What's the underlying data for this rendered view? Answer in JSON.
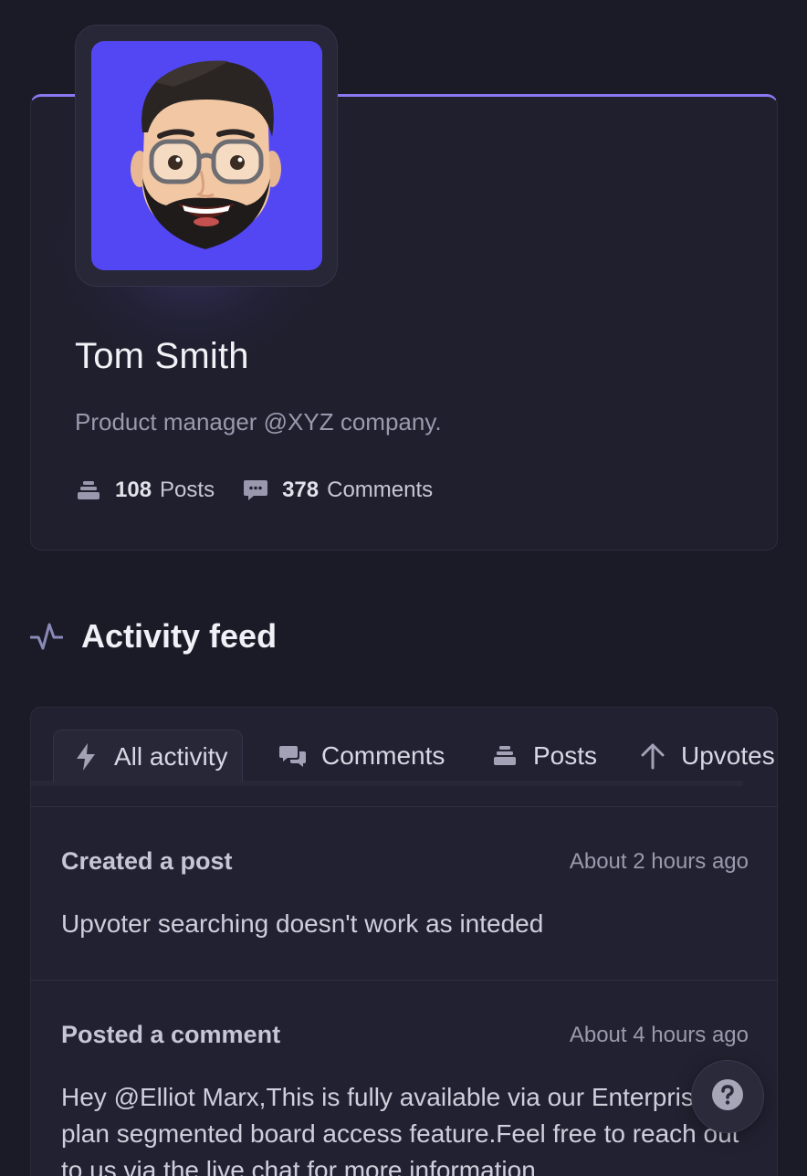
{
  "profile": {
    "name": "Tom Smith",
    "bio": "Product manager @XYZ company.",
    "stats": [
      {
        "count": "108",
        "label": "Posts",
        "icon": "stack-icon"
      },
      {
        "count": "378",
        "label": "Comments",
        "icon": "comment-bubble-icon"
      }
    ]
  },
  "feed": {
    "title": "Activity feed",
    "tabs": [
      {
        "label": "All activity",
        "icon": "bolt-icon",
        "active": true
      },
      {
        "label": "Comments",
        "icon": "comments-icon",
        "active": false
      },
      {
        "label": "Posts",
        "icon": "stack-icon",
        "active": false
      },
      {
        "label": "Upvotes",
        "icon": "arrow-up-icon",
        "active": false
      }
    ],
    "items": [
      {
        "action": "Created a post",
        "time": "About 2 hours ago",
        "body": "Upvoter searching doesn't work as inteded"
      },
      {
        "action": "Posted a comment",
        "time": "About 4 hours ago",
        "body": "Hey @Elliot Marx,This is fully available via our Enterprise plan segmented board access feature.Feel free to reach out to us via the live chat for more information."
      }
    ]
  },
  "colors": {
    "background": "#1b1b27",
    "card": "#1f1f2e",
    "accent": "#8b78f0",
    "avatar_bg": "#5347f4"
  }
}
